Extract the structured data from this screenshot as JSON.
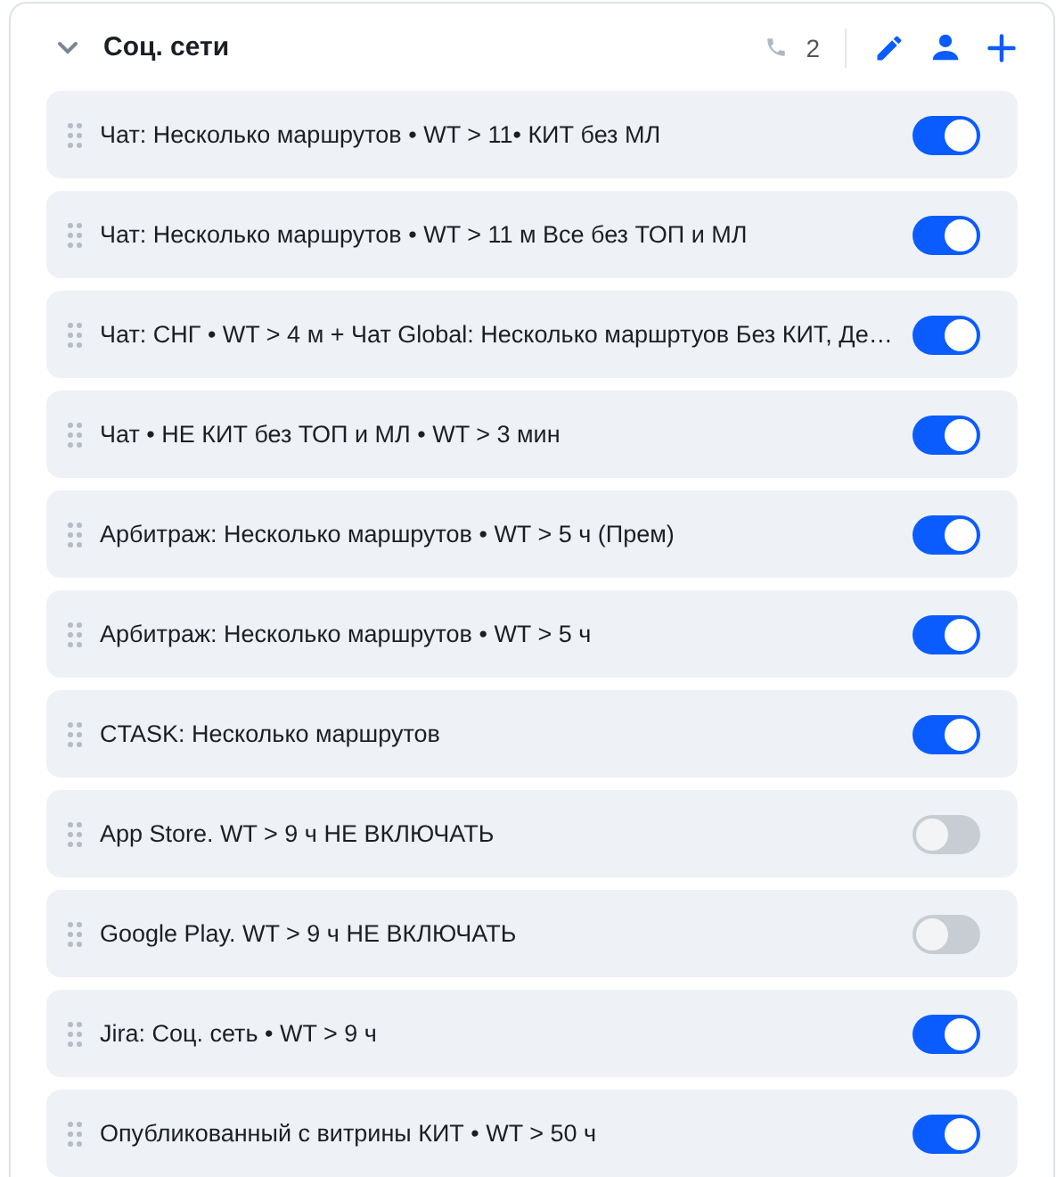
{
  "group": {
    "title": "Соц. сети",
    "expanded": true,
    "count": "2"
  },
  "rows": [
    {
      "label": "Чат: Несколько маршрутов • WT > 11• КИТ без МЛ",
      "on": true
    },
    {
      "label": "Чат: Несколько маршрутов • WT > 11 м Все без ТОП и МЛ",
      "on": true
    },
    {
      "label": "Чат: СНГ • WT > 4 м + Чат Global: Несколько маршртуов Без КИТ, Де…",
      "on": true
    },
    {
      "label": "Чат • НЕ КИТ без ТОП и МЛ • WT > 3 мин",
      "on": true
    },
    {
      "label": "Арбитраж: Несколько маршрутов • WT > 5 ч (Прем)",
      "on": true
    },
    {
      "label": "Арбитраж: Несколько маршрутов • WT > 5 ч",
      "on": true
    },
    {
      "label": "CTASK: Несколько маршрутов",
      "on": true
    },
    {
      "label": "App Store. WT > 9 ч НЕ ВКЛЮЧАТЬ",
      "on": false
    },
    {
      "label": "Google Play. WT > 9 ч НЕ ВКЛЮЧАТЬ",
      "on": false
    },
    {
      "label": "Jira: Соц. сеть • WT > 9 ч",
      "on": true
    },
    {
      "label": "Опубликованный с витрины КИТ • WT > 50 ч",
      "on": true
    }
  ]
}
